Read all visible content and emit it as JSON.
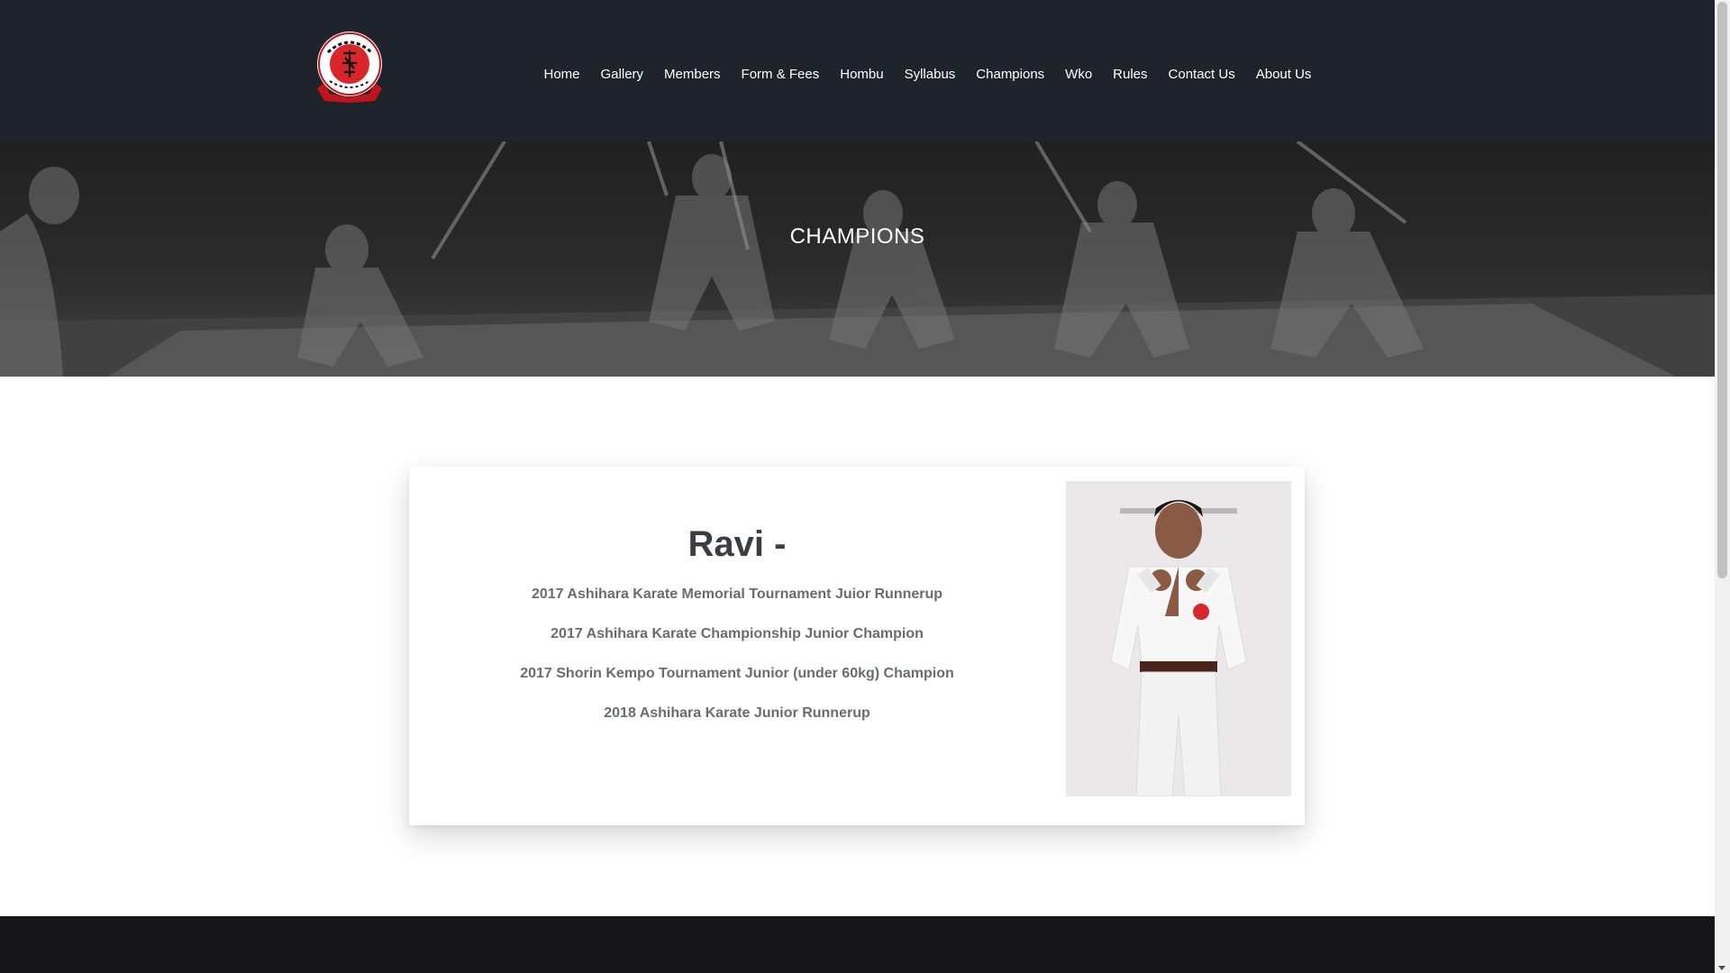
{
  "header": {
    "logo_icon": "club-crest-logo-icon",
    "nav": [
      {
        "label": "Home"
      },
      {
        "label": "Gallery"
      },
      {
        "label": "Members"
      },
      {
        "label": "Form & Fees"
      },
      {
        "label": "Hombu"
      },
      {
        "label": "Syllabus"
      },
      {
        "label": "Champions"
      },
      {
        "label": "Wko"
      },
      {
        "label": "Rules"
      },
      {
        "label": "Contact Us"
      },
      {
        "label": "About Us"
      }
    ]
  },
  "hero": {
    "title": "CHAMPIONS"
  },
  "champion": {
    "name": "Ravi -",
    "achievements": [
      "2017 Ashihara Karate Memorial Tournament Juior Runnerup",
      "2017 Ashihara Karate Championship Junior Champion",
      "2017 Shorin Kempo Tournament Junior (under 60kg) Champion",
      "2018 Ashihara Karate Junior Runnerup"
    ],
    "photo_icon": "champion-photo"
  },
  "colors": {
    "header_bg": "#1f232b",
    "footer_bg": "#16161a",
    "logo_red": "#d8262b"
  }
}
